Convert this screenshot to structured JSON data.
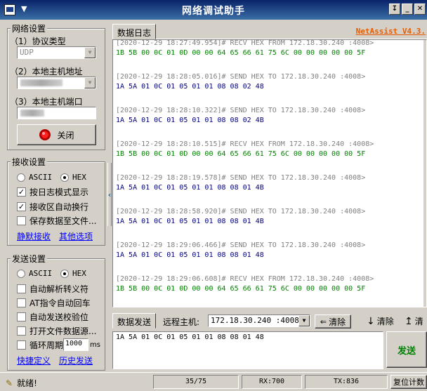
{
  "window": {
    "title": "网络调试助手"
  },
  "settings": {
    "group_label": "网络设置",
    "protocol_label": "（1）协议类型",
    "protocol_value": "UDP",
    "host_ip_label": "（2）本地主机地址",
    "host_port_label": "（3）本地主机端口",
    "close_button_label": "关闭"
  },
  "receive": {
    "group_label": "接收设置",
    "ascii_label": "ASCII",
    "hex_label": "HEX",
    "log_mode_label": "按日志模式显示",
    "auto_wrap_label": "接收区自动换行",
    "save_to_file_label": "保存数据至文件...",
    "silent_link": "静默接收",
    "other_options_link": "其他选项"
  },
  "send_settings": {
    "group_label": "发送设置",
    "ascii_label": "ASCII",
    "hex_label": "HEX",
    "auto_escape_label": "自动解析转义符",
    "at_cr_label": "AT指令自动回车",
    "auto_checksum_label": "自动发送校验位",
    "open_file_label": "打开文件数据源...",
    "loop_label": "循环周期",
    "loop_value": "1000",
    "loop_unit": "ms",
    "shortcut_link": "快捷定义",
    "history_link": "历史发送"
  },
  "log_panel": {
    "tab_label": "数据日志",
    "brand": "NetAssist V4.3.",
    "entries": [
      {
        "ts": "[2020-12-29 18:27:49.954]# RECV HEX FROM 172.18.30.240 :4008>",
        "data": "1B 5B 00 0C 01 0D 00 00 64 65 66 61 75 6C 00 00 00 00 00 5F",
        "kind": "recv"
      },
      {
        "ts": "[2020-12-29 18:28:05.016]# SEND HEX TO 172.18.30.240 :4008>",
        "data": "1A 5A 01 0C 01 05 01 01 08 08 02 48",
        "kind": "send"
      },
      {
        "ts": "[2020-12-29 18:28:10.322]# SEND HEX TO 172.18.30.240 :4008>",
        "data": "1A 5A 01 0C 01 05 01 01 08 08 02 4B",
        "kind": "send"
      },
      {
        "ts": "[2020-12-29 18:28:10.515]# RECV HEX FROM 172.18.30.240 :4008>",
        "data": "1B 5B 00 0C 01 0D 00 00 64 65 66 61 75 6C 00 00 00 00 00 5F",
        "kind": "recv"
      },
      {
        "ts": "[2020-12-29 18:28:19.578]# SEND HEX TO 172.18.30.240 :4008>",
        "data": "1A 5A 01 0C 01 05 01 01 08 08 01 4B",
        "kind": "send"
      },
      {
        "ts": "[2020-12-29 18:28:58.920]# SEND HEX TO 172.18.30.240 :4008>",
        "data": "1A 5A 01 0C 01 05 01 01 08 08 01 4B",
        "kind": "send"
      },
      {
        "ts": "[2020-12-29 18:29:06.466]# SEND HEX TO 172.18.30.240 :4008>",
        "data": "1A 5A 01 0C 01 05 01 01 08 08 01 48",
        "kind": "send"
      },
      {
        "ts": "[2020-12-29 18:29:06.608]# RECV HEX FROM 172.18.30.240 :4008>",
        "data": "1B 5B 00 0C 01 0D 00 00 64 65 66 61 75 6C 00 00 00 00 00 5F",
        "kind": "recv"
      }
    ]
  },
  "send_panel": {
    "tab_label": "数据发送",
    "remote_label": "远程主机:",
    "remote_value": "172.18.30.240 :4008",
    "clear_label": "清除",
    "clear2_label": "清除",
    "clear3_label": "清",
    "input_value": "1A 5A 01 0C 01 05 01 01 08 08 01 48",
    "send_button": "发送"
  },
  "status": {
    "ready": "就绪!",
    "count": "35/75",
    "rx": "RX:700",
    "tx": "TX:836",
    "reset": "复位计数"
  }
}
